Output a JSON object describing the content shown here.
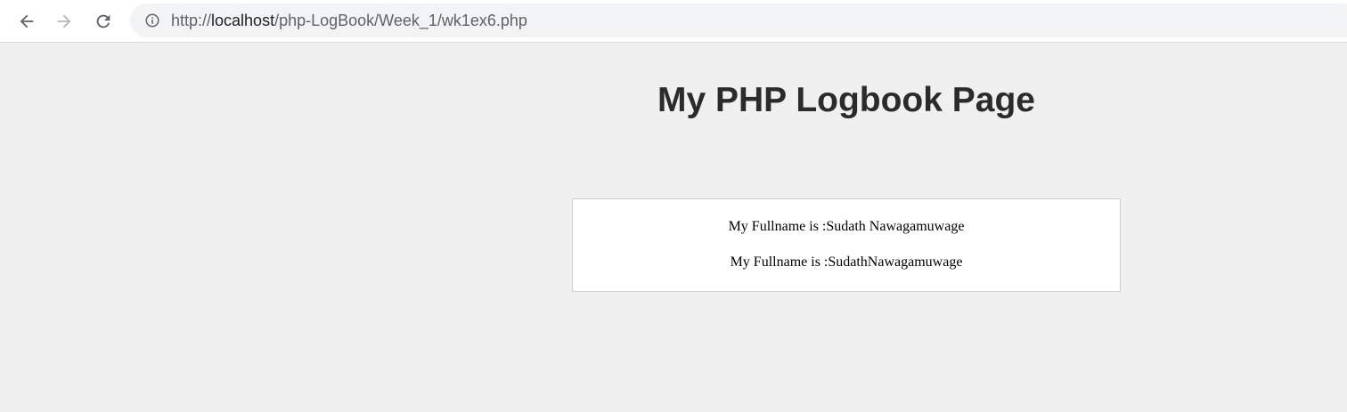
{
  "browser": {
    "url_prefix": "http://",
    "url_host": "localhost",
    "url_path": "/php-LogBook/Week_1/wk1ex6.php"
  },
  "icons": {
    "back": "arrow-left-icon",
    "forward": "arrow-right-icon",
    "reload": "reload-icon",
    "info": "info-icon"
  },
  "colors": {
    "page_background": "#f0f0f0",
    "toolbar_background": "#ffffff",
    "omnibox_background": "#f1f3f4",
    "heading": "#2b2b2b",
    "box_border": "#cfcfcf"
  },
  "page": {
    "heading": "My PHP Logbook Page",
    "lines": [
      "My Fullname is :Sudath Nawagamuwage",
      "My Fullname is :SudathNawagamuwage"
    ]
  }
}
